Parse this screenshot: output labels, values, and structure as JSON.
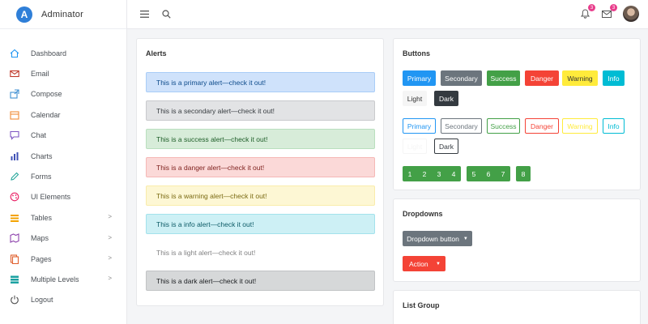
{
  "brand": {
    "logo_letter": "A",
    "name": "Adminator"
  },
  "sidebar": {
    "items": [
      {
        "label": "Dashboard",
        "color": "#2196f3",
        "chevron": false
      },
      {
        "label": "Email",
        "color": "#c0392b",
        "chevron": false
      },
      {
        "label": "Compose",
        "color": "#3f8fd2",
        "chevron": false
      },
      {
        "label": "Calendar",
        "color": "#f08c3a",
        "chevron": false
      },
      {
        "label": "Chat",
        "color": "#7e57c2",
        "chevron": false
      },
      {
        "label": "Charts",
        "color": "#3f51b5",
        "chevron": false
      },
      {
        "label": "Forms",
        "color": "#26a69a",
        "chevron": false
      },
      {
        "label": "UI Elements",
        "color": "#e91e63",
        "chevron": false
      },
      {
        "label": "Tables",
        "color": "#f4a300",
        "chevron": true
      },
      {
        "label": "Maps",
        "color": "#8e44ad",
        "chevron": true
      },
      {
        "label": "Pages",
        "color": "#e0602f",
        "chevron": true
      },
      {
        "label": "Multiple Levels",
        "color": "#1aa1a1",
        "chevron": true
      },
      {
        "label": "Logout",
        "color": "#555555",
        "chevron": false
      }
    ]
  },
  "topbar": {
    "notifications_count": "3",
    "messages_count": "3"
  },
  "alerts_card": {
    "title": "Alerts",
    "alerts": [
      {
        "text": "This is a primary alert—check it out!",
        "bg": "#cfe2fb",
        "border": "#a9cdf7",
        "color": "#0c4a8a"
      },
      {
        "text": "This is a secondary alert—check it out!",
        "bg": "#e2e3e5",
        "border": "#c9cacd",
        "color": "#383d41"
      },
      {
        "text": "This is a success alert—check it out!",
        "bg": "#d7ecd9",
        "border": "#b9dfbe",
        "color": "#1d5d27"
      },
      {
        "text": "This is a danger alert—check it out!",
        "bg": "#fbd9d8",
        "border": "#f5b8b6",
        "color": "#7d1f1c"
      },
      {
        "text": "This is a warning alert—check it out!",
        "bg": "#fdf7d4",
        "border": "#f9ecab",
        "color": "#7a6a12"
      },
      {
        "text": "This is a info alert—check it out!",
        "bg": "#cdf0f5",
        "border": "#a3e2ec",
        "color": "#0c5a66"
      },
      {
        "text": "This is a light alert—check it out!",
        "bg": "#ffffff",
        "border": "#ffffff",
        "color": "#818182"
      },
      {
        "text": "This is a dark alert—check it out!",
        "bg": "#d6d8d9",
        "border": "#c1c3c5",
        "color": "#1b1e21"
      }
    ]
  },
  "buttons_card": {
    "title": "Buttons",
    "solid": [
      {
        "label": "Primary",
        "bg": "#2196f3",
        "color": "#ffffff"
      },
      {
        "label": "Secondary",
        "bg": "#6c757d",
        "color": "#ffffff"
      },
      {
        "label": "Success",
        "bg": "#43a047",
        "color": "#ffffff"
      },
      {
        "label": "Danger",
        "bg": "#f44336",
        "color": "#ffffff"
      },
      {
        "label": "Warning",
        "bg": "#ffeb3b",
        "color": "#333333"
      },
      {
        "label": "Info",
        "bg": "#00bcd4",
        "color": "#ffffff"
      },
      {
        "label": "Light",
        "bg": "#f5f5f5",
        "color": "#333333"
      },
      {
        "label": "Dark",
        "bg": "#343a40",
        "color": "#ffffff"
      }
    ],
    "outline": [
      {
        "label": "Primary",
        "color": "#2196f3"
      },
      {
        "label": "Secondary",
        "color": "#6c757d"
      },
      {
        "label": "Success",
        "color": "#43a047"
      },
      {
        "label": "Danger",
        "color": "#f44336"
      },
      {
        "label": "Warning",
        "color": "#ffeb3b"
      },
      {
        "label": "Info",
        "color": "#00bcd4"
      },
      {
        "label": "Light",
        "color": "#f5f5f5"
      },
      {
        "label": "Dark",
        "color": "#343a40"
      }
    ],
    "groups": [
      [
        "1",
        "2",
        "3",
        "4"
      ],
      [
        "5",
        "6",
        "7"
      ],
      [
        "8"
      ]
    ]
  },
  "dropdowns_card": {
    "title": "Dropdowns",
    "dropdown_label": "Dropdown button",
    "split_label": "Action"
  },
  "list_group_card": {
    "title": "List Group"
  }
}
